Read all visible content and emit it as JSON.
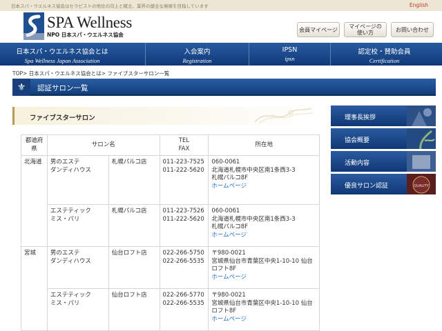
{
  "topbar": {
    "tagline": "日本スパ・ウエルネス協会はセラピストの地位の向上と確立、業界の健全な発展を目指しています",
    "english_link": "English"
  },
  "logo": {
    "name": "SPA Wellness",
    "subtitle": "NPO 日本スパ・ウエルネス協会"
  },
  "header_buttons": [
    {
      "label": "会員マイページ"
    },
    {
      "label": "マイページの\n使い方"
    },
    {
      "label": "お問い合わせ"
    }
  ],
  "nav": [
    {
      "jp": "日本スパ・ウエルネス協会とは",
      "en": "Spa Wellness Japan Association"
    },
    {
      "jp": "入会案内",
      "en": "Registration"
    },
    {
      "jp": "IPSN",
      "en": "ipsn"
    },
    {
      "jp": "認定校・賛助会員",
      "en": "Certification"
    }
  ],
  "breadcrumb": {
    "items": [
      "TOP",
      "日本スパ・ウエルネス協会とは",
      "ファイブスターサロン一覧"
    ],
    "separator": ">"
  },
  "page_title": "認証サロン一覧",
  "section_title": "ファイブスターサロン",
  "table": {
    "headers": {
      "prefecture": "都道府県",
      "salon": "サロン名",
      "tel": "TEL",
      "fax": "FAX",
      "address": "所在地"
    },
    "groups": [
      {
        "prefecture": "北海道",
        "rows": [
          {
            "name": "男のエステ\nダンディハウス",
            "branch": "札幌パルコ店",
            "tel": "011-223-7525",
            "fax": "011-222-5620",
            "zip": "060-0061",
            "address": "北海道札幌市中央区南1条西3-3\n札幌パルコ8F",
            "link": "ホームページ"
          },
          {
            "name": "エステティック\nミス・パリ",
            "branch": "札幌パルコ店",
            "tel": "011-223-7526",
            "fax": "011-222-5620",
            "zip": "060-0061",
            "address": "北海道札幌市中央区南1条西3-3\n札幌パルコ8F",
            "link": "ホームページ"
          }
        ]
      },
      {
        "prefecture": "宮城",
        "rows": [
          {
            "name": "男のエステ\nダンディハウス",
            "branch": "仙台ロフト店",
            "tel": "022-266-5750",
            "fax": "022-266-5535",
            "zip": "〒980-0021",
            "address": "宮城県仙台市青葉区中央1-10-10 仙台ロフト8F",
            "link": "ホームページ"
          },
          {
            "name": "エステティック\nミス・パリ",
            "branch": "仙台ロフト店",
            "tel": "022-266-5770",
            "fax": "022-266-5535",
            "zip": "〒980-0021",
            "address": "宮城県仙台市青葉区中央1-10-10 仙台ロフト8F",
            "link": "ホームページ"
          }
        ]
      }
    ]
  },
  "sidebar": [
    {
      "label": "理事長挨拶"
    },
    {
      "label": "協会概要"
    },
    {
      "label": "活動内容"
    },
    {
      "label": "優良サロン認証",
      "thumb_text": "QUALITY"
    }
  ],
  "colors": {
    "nav_blue": "#1b4a8c",
    "link_blue": "#1a6fd0",
    "gold": "#b79b57",
    "english_red": "#c0392b"
  }
}
